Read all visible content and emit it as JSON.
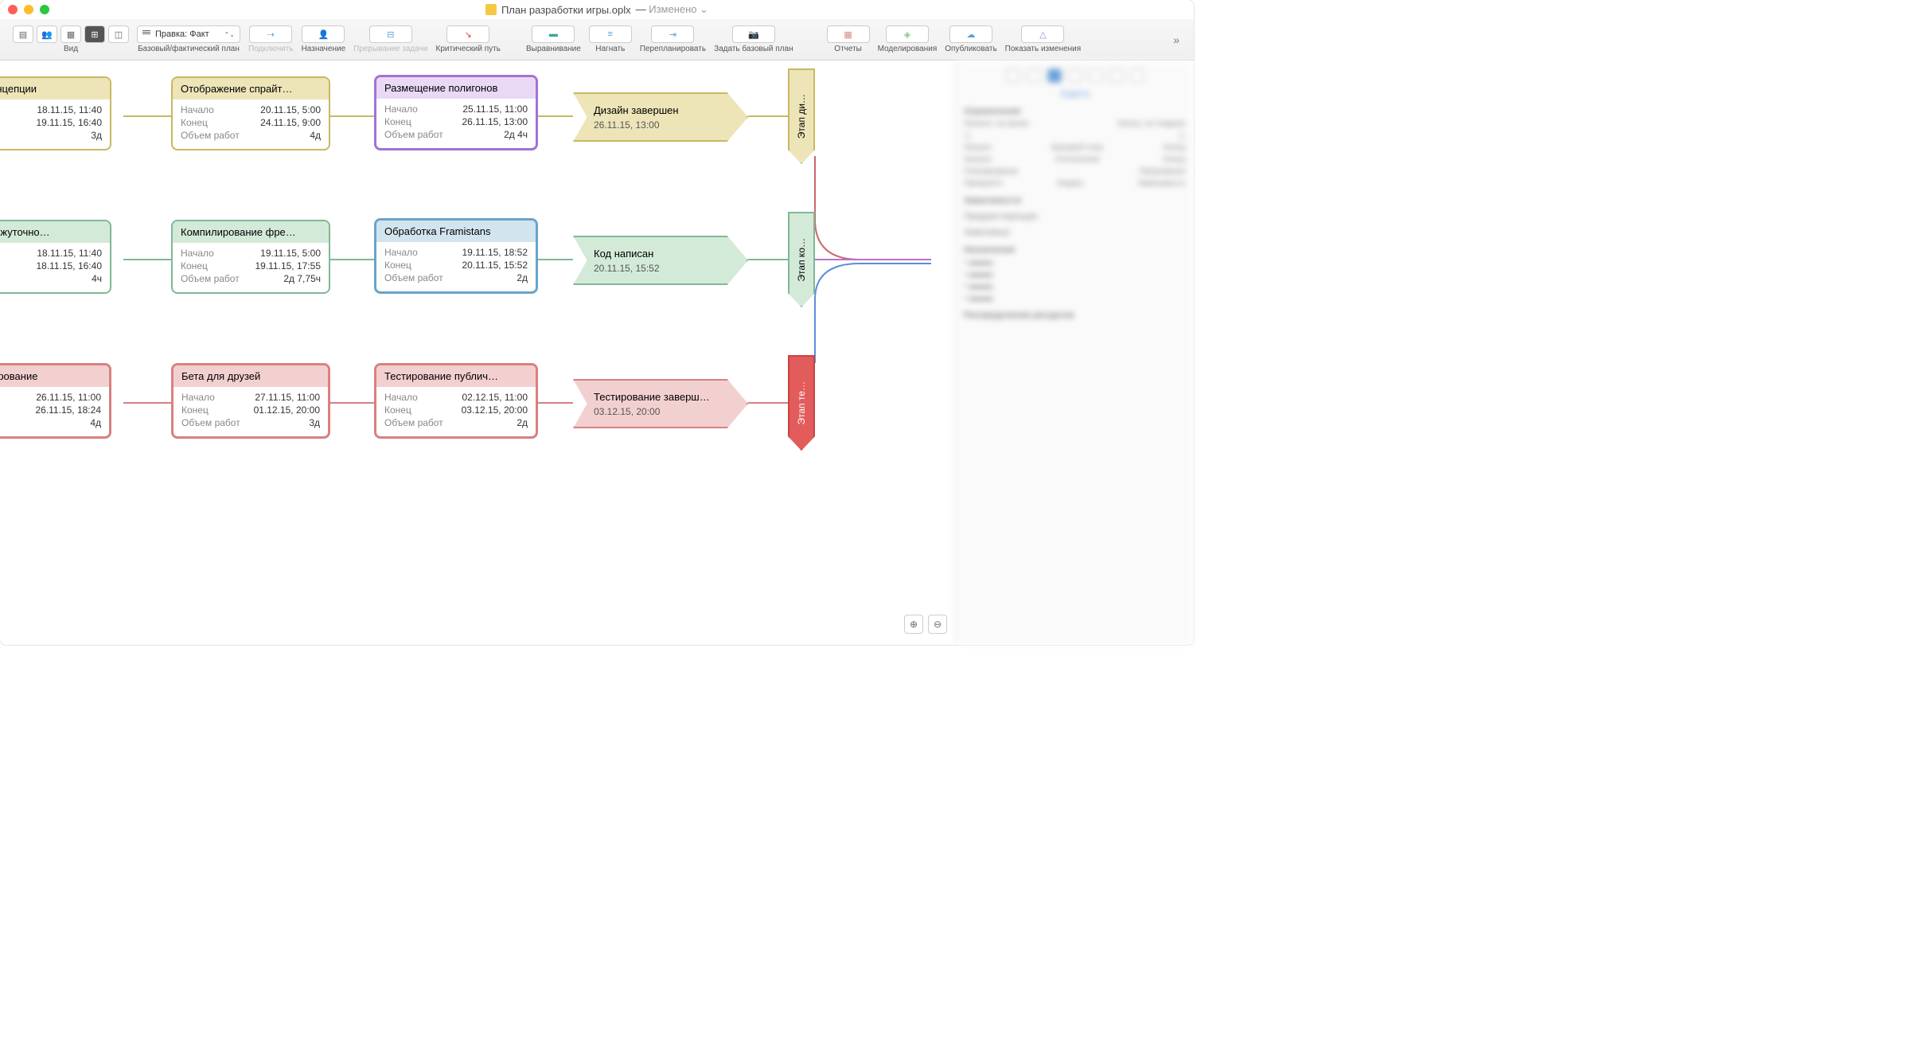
{
  "window": {
    "title": "План разработки игры.oplx",
    "modified": "Изменено"
  },
  "toolbar": {
    "view": "Вид",
    "dropdown": "Правка: Факт",
    "baseline": "Базовый/фактический план",
    "connect": "Подключить",
    "assign": "Назначение",
    "split": "Прерывание задачи",
    "critical": "Критический путь",
    "leveling": "Выравнивание",
    "catchup": "Нагнать",
    "reschedule": "Перепланировать",
    "setbaseline": "Задать базовый план",
    "reports": "Отчеты",
    "simulations": "Моделирования",
    "publish": "Опубликовать",
    "changes": "Показать изменения"
  },
  "labels": {
    "start": "Начало",
    "end": "Конец",
    "effort": "Объем работ"
  },
  "tasks": {
    "concept": {
      "title": "оски концепции",
      "start": "18.11.15, 11:40",
      "end": "19.11.15, 16:40",
      "effort": "3д"
    },
    "sprite": {
      "title": "Отображение спрайт…",
      "start": "20.11.15, 5:00",
      "end": "24.11.15, 9:00",
      "effort": "4д"
    },
    "polygon": {
      "title": "Размещение полигонов",
      "start": "25.11.15, 11:00",
      "end": "26.11.15, 13:00",
      "effort": "2д 4ч"
    },
    "middleware": {
      "title": "р промежуточно…",
      "start": "18.11.15, 11:40",
      "end": "18.11.15, 16:40",
      "effort": "4ч"
    },
    "compile": {
      "title": "Компилирование фре…",
      "start": "19.11.15, 5:00",
      "end": "19.11.15, 17:55",
      "effort": "2д 7,75ч"
    },
    "framistans": {
      "title": "Обработка Framistans",
      "start": "19.11.15, 18:52",
      "end": "20.11.15, 15:52",
      "effort": "2д"
    },
    "alpha": {
      "title": "а-тестирование",
      "start": "26.11.15, 11:00",
      "end": "26.11.15, 18:24",
      "effort": "4д"
    },
    "beta": {
      "title": "Бета для друзей",
      "start": "27.11.15, 11:00",
      "end": "01.12.15, 20:00",
      "effort": "3д"
    },
    "public": {
      "title": "Тестирование публич…",
      "start": "02.12.15, 11:00",
      "end": "03.12.15, 20:00",
      "effort": "2д"
    }
  },
  "milestones": {
    "design": {
      "title": "Дизайн завершен",
      "date": "26.11.15, 13:00"
    },
    "code": {
      "title": "Код написан",
      "date": "20.11.15, 15:52"
    },
    "test": {
      "title": "Тестирование заверш…",
      "date": "03.12.15, 20:00"
    }
  },
  "phases": {
    "design": "Этап ди…",
    "code": "Этап ко…",
    "test": "Этап те…"
  },
  "inspector": {
    "tab": "Задача",
    "h1": "Ограничения",
    "start_early": "Начало: не ранее",
    "end_late": "Конец: не позднее",
    "h2": "Базовый план",
    "start": "Начало",
    "end": "Конец",
    "h3": "Отклонение",
    "h4": "Планирование",
    "h5": "Прерывание",
    "priority": "Приоритет",
    "index": "Индекс",
    "depends": "Зависимость",
    "h6": "Зависимости",
    "h7": "Предшествующие",
    "h8": "Зависимые",
    "h9": "Назначения",
    "h10": "Распределение ресурсов"
  }
}
